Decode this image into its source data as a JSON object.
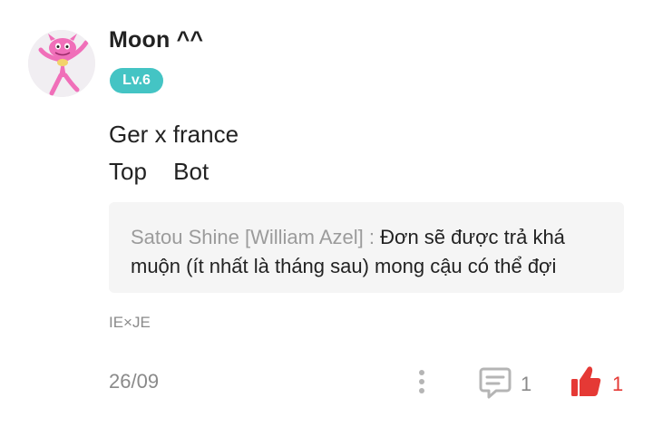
{
  "comment": {
    "username": "Moon ^^",
    "level": "Lv.6",
    "body_line1": "Ger x france",
    "body_line2": "Top Bot",
    "quote": {
      "author": "Satou Shine [William Azel] :",
      "text": "Đơn sẽ được trả khá muộn (ít nhất là tháng sau) mong cậu có thể đợi"
    },
    "tag": "IE×JE",
    "date": "26/09",
    "reply_count": "1",
    "like_count": "1"
  },
  "colors": {
    "level_badge": "#44c4c4",
    "like_accent": "#e53935",
    "muted_text": "#8a8a8a",
    "quote_bg": "#f5f5f5"
  },
  "icons": {
    "avatar": "pink-cartoon-character-avatar",
    "more": "vertical-dots-icon",
    "reply": "speech-bubble-icon",
    "like": "thumbs-up-icon"
  }
}
